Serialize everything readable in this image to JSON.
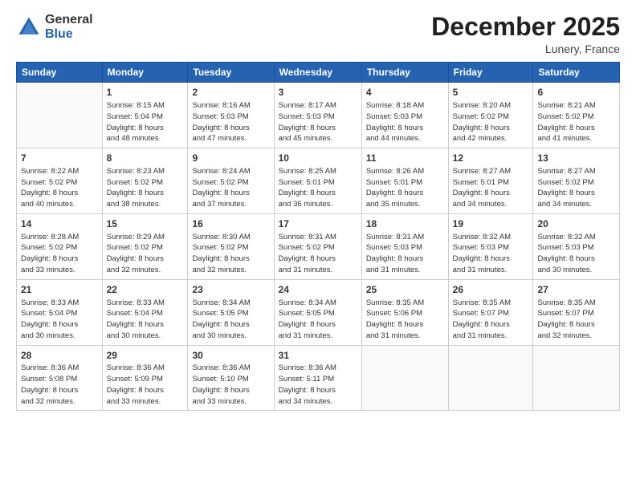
{
  "logo": {
    "general": "General",
    "blue": "Blue"
  },
  "title": "December 2025",
  "subtitle": "Lunery, France",
  "days_of_week": [
    "Sunday",
    "Monday",
    "Tuesday",
    "Wednesday",
    "Thursday",
    "Friday",
    "Saturday"
  ],
  "weeks": [
    [
      {
        "day": "",
        "info": ""
      },
      {
        "day": "1",
        "info": "Sunrise: 8:15 AM\nSunset: 5:04 PM\nDaylight: 8 hours\nand 48 minutes."
      },
      {
        "day": "2",
        "info": "Sunrise: 8:16 AM\nSunset: 5:03 PM\nDaylight: 8 hours\nand 47 minutes."
      },
      {
        "day": "3",
        "info": "Sunrise: 8:17 AM\nSunset: 5:03 PM\nDaylight: 8 hours\nand 45 minutes."
      },
      {
        "day": "4",
        "info": "Sunrise: 8:18 AM\nSunset: 5:03 PM\nDaylight: 8 hours\nand 44 minutes."
      },
      {
        "day": "5",
        "info": "Sunrise: 8:20 AM\nSunset: 5:02 PM\nDaylight: 8 hours\nand 42 minutes."
      },
      {
        "day": "6",
        "info": "Sunrise: 8:21 AM\nSunset: 5:02 PM\nDaylight: 8 hours\nand 41 minutes."
      }
    ],
    [
      {
        "day": "7",
        "info": "Sunrise: 8:22 AM\nSunset: 5:02 PM\nDaylight: 8 hours\nand 40 minutes."
      },
      {
        "day": "8",
        "info": "Sunrise: 8:23 AM\nSunset: 5:02 PM\nDaylight: 8 hours\nand 38 minutes."
      },
      {
        "day": "9",
        "info": "Sunrise: 8:24 AM\nSunset: 5:02 PM\nDaylight: 8 hours\nand 37 minutes."
      },
      {
        "day": "10",
        "info": "Sunrise: 8:25 AM\nSunset: 5:01 PM\nDaylight: 8 hours\nand 36 minutes."
      },
      {
        "day": "11",
        "info": "Sunrise: 8:26 AM\nSunset: 5:01 PM\nDaylight: 8 hours\nand 35 minutes."
      },
      {
        "day": "12",
        "info": "Sunrise: 8:27 AM\nSunset: 5:01 PM\nDaylight: 8 hours\nand 34 minutes."
      },
      {
        "day": "13",
        "info": "Sunrise: 8:27 AM\nSunset: 5:02 PM\nDaylight: 8 hours\nand 34 minutes."
      }
    ],
    [
      {
        "day": "14",
        "info": "Sunrise: 8:28 AM\nSunset: 5:02 PM\nDaylight: 8 hours\nand 33 minutes."
      },
      {
        "day": "15",
        "info": "Sunrise: 8:29 AM\nSunset: 5:02 PM\nDaylight: 8 hours\nand 32 minutes."
      },
      {
        "day": "16",
        "info": "Sunrise: 8:30 AM\nSunset: 5:02 PM\nDaylight: 8 hours\nand 32 minutes."
      },
      {
        "day": "17",
        "info": "Sunrise: 8:31 AM\nSunset: 5:02 PM\nDaylight: 8 hours\nand 31 minutes."
      },
      {
        "day": "18",
        "info": "Sunrise: 8:31 AM\nSunset: 5:03 PM\nDaylight: 8 hours\nand 31 minutes."
      },
      {
        "day": "19",
        "info": "Sunrise: 8:32 AM\nSunset: 5:03 PM\nDaylight: 8 hours\nand 31 minutes."
      },
      {
        "day": "20",
        "info": "Sunrise: 8:32 AM\nSunset: 5:03 PM\nDaylight: 8 hours\nand 30 minutes."
      }
    ],
    [
      {
        "day": "21",
        "info": "Sunrise: 8:33 AM\nSunset: 5:04 PM\nDaylight: 8 hours\nand 30 minutes."
      },
      {
        "day": "22",
        "info": "Sunrise: 8:33 AM\nSunset: 5:04 PM\nDaylight: 8 hours\nand 30 minutes."
      },
      {
        "day": "23",
        "info": "Sunrise: 8:34 AM\nSunset: 5:05 PM\nDaylight: 8 hours\nand 30 minutes."
      },
      {
        "day": "24",
        "info": "Sunrise: 8:34 AM\nSunset: 5:05 PM\nDaylight: 8 hours\nand 31 minutes."
      },
      {
        "day": "25",
        "info": "Sunrise: 8:35 AM\nSunset: 5:06 PM\nDaylight: 8 hours\nand 31 minutes."
      },
      {
        "day": "26",
        "info": "Sunrise: 8:35 AM\nSunset: 5:07 PM\nDaylight: 8 hours\nand 31 minutes."
      },
      {
        "day": "27",
        "info": "Sunrise: 8:35 AM\nSunset: 5:07 PM\nDaylight: 8 hours\nand 32 minutes."
      }
    ],
    [
      {
        "day": "28",
        "info": "Sunrise: 8:36 AM\nSunset: 5:08 PM\nDaylight: 8 hours\nand 32 minutes."
      },
      {
        "day": "29",
        "info": "Sunrise: 8:36 AM\nSunset: 5:09 PM\nDaylight: 8 hours\nand 33 minutes."
      },
      {
        "day": "30",
        "info": "Sunrise: 8:36 AM\nSunset: 5:10 PM\nDaylight: 8 hours\nand 33 minutes."
      },
      {
        "day": "31",
        "info": "Sunrise: 8:36 AM\nSunset: 5:11 PM\nDaylight: 8 hours\nand 34 minutes."
      },
      {
        "day": "",
        "info": ""
      },
      {
        "day": "",
        "info": ""
      },
      {
        "day": "",
        "info": ""
      }
    ]
  ]
}
